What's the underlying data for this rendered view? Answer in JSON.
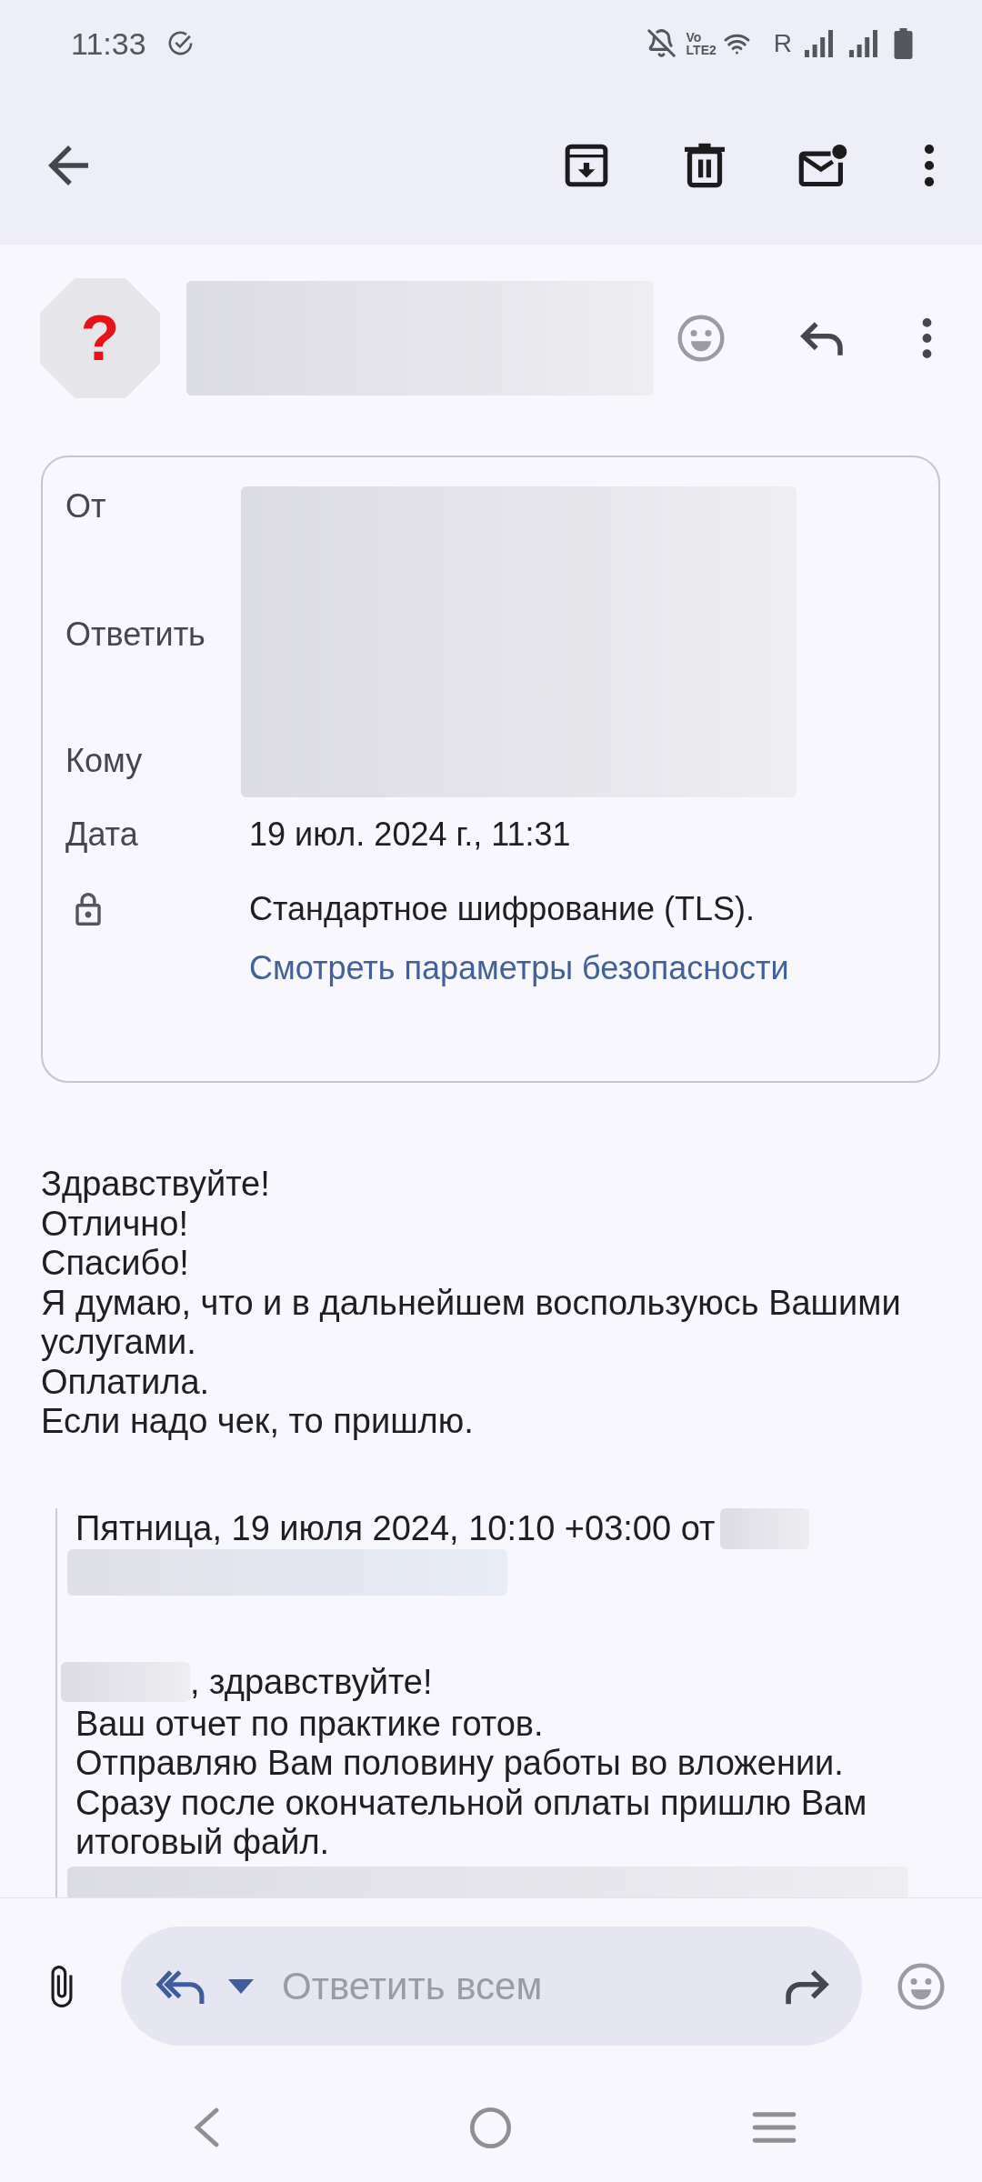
{
  "status_bar": {
    "time": "11:33",
    "volte": {
      "top": "Vo",
      "bottom": "LTE2"
    },
    "roaming": "R"
  },
  "sender": {
    "avatar_mark": "?"
  },
  "details": {
    "rows": [
      {
        "kind": "contact",
        "label": "От"
      },
      {
        "kind": "contact",
        "label": "Ответить"
      },
      {
        "kind": "contact",
        "label": "Кому"
      },
      {
        "kind": "date",
        "label": "Дата",
        "value": "19 июл. 2024 г., 11:31"
      },
      {
        "kind": "security",
        "value": "Стандартное шифрование (TLS).",
        "link": "Смотреть параметры безопасности"
      }
    ]
  },
  "body": {
    "lines": [
      "Здравствуйте!",
      "Отлично!",
      "Спасибо!",
      "Я думаю, что и в дальнейшем воспользуюсь Вашими услугами.",
      "Оплатила.",
      "Если надо чек, то пришлю."
    ]
  },
  "quote": {
    "header": "Пятница, 19 июля 2024, 10:10 +03:00 от",
    "greeting": ", здравствуйте!",
    "lines": [
      "Ваш отчет по практике готов.",
      "Отправляю Вам половину работы во вложении.",
      "Сразу после окончательной оплаты пришлю Вам итоговый файл."
    ]
  },
  "reply_bar": {
    "placeholder": "Ответить всем"
  }
}
